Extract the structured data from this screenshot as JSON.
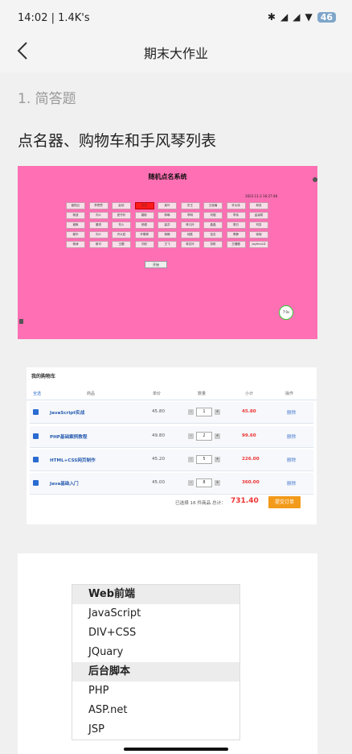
{
  "status_bar": {
    "time": "14:02 | 1.4K's",
    "battery": "46"
  },
  "header": {
    "title": "期末大作业"
  },
  "section": "1. 简答题",
  "question_title": "点名器、购物车和手风琴列表",
  "rollcall": {
    "title": "随机点名系统",
    "datetime": "2022-11-2 16:27:48",
    "names": [
      "欧阳云",
      "李思思",
      "赵欣",
      "王五",
      "吴叶",
      "史王",
      "王晓楠",
      "许大伟",
      "林凯",
      "杨波",
      "刘人",
      "夏书玲",
      "翻彩",
      "林琳",
      "李明",
      "刘靓",
      "李伟",
      "孟凌尉",
      "谢枫",
      "董悦",
      "刘人",
      "杨丽",
      "高芬",
      "林凡玲",
      "晶晶",
      "周日",
      "刘凯",
      "程华",
      "刘人",
      "许大四",
      "许啸啸",
      "杨静",
      "徐胜",
      "伍志",
      "蔡静",
      "徐妮",
      "杨涛",
      "斯可",
      "王圆",
      "刘欣",
      "王飞",
      "林志玲",
      "张帆",
      "王璐璐",
      "JayHenLD"
    ],
    "highlight_index": 3,
    "start_label": "开始",
    "timer": "7'0s"
  },
  "cart": {
    "title": "我的购物车",
    "columns": [
      "全选",
      "商品",
      "单价",
      "数量",
      "小计",
      "操作"
    ],
    "rows": [
      {
        "name": "JavaScript实战",
        "price": "45.80",
        "qty": "1",
        "subtotal": "45.80",
        "action": "删除"
      },
      {
        "name": "PHP基础案例教程",
        "price": "49.80",
        "qty": "2",
        "subtotal": "99.60",
        "action": "删除"
      },
      {
        "name": "HTML+CSS网页制作",
        "price": "45.20",
        "qty": "5",
        "subtotal": "226.00",
        "action": "删除"
      },
      {
        "name": "Java基础入门",
        "price": "45.00",
        "qty": "8",
        "subtotal": "360.00",
        "action": "删除"
      }
    ],
    "summary": "已选择 16 件商品 总计：",
    "total": "731.40",
    "submit_label": "提交订单"
  },
  "accordion": {
    "groups": [
      {
        "title": "Web前端",
        "items": [
          "JavaScript",
          "DIV+CSS",
          "JQuary"
        ]
      },
      {
        "title": "后台脚本",
        "items": [
          "PHP",
          "ASP.net",
          "JSP"
        ]
      }
    ]
  }
}
